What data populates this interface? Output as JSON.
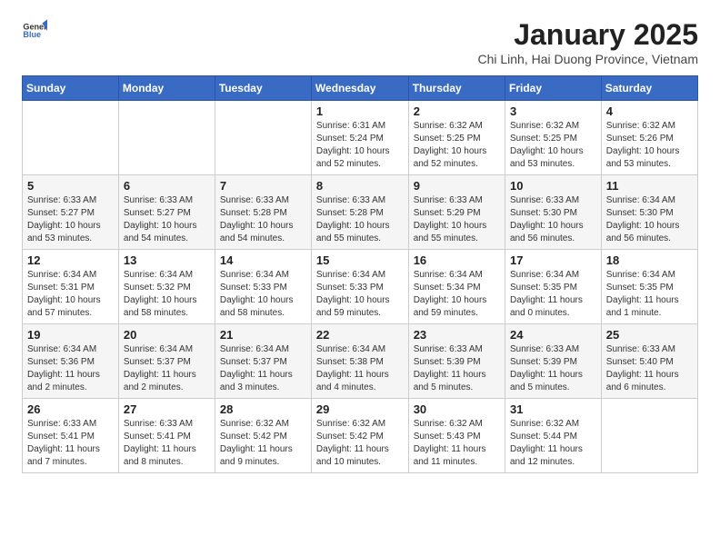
{
  "logo": {
    "general": "General",
    "blue": "Blue"
  },
  "title": "January 2025",
  "subtitle": "Chi Linh, Hai Duong Province, Vietnam",
  "days_of_week": [
    "Sunday",
    "Monday",
    "Tuesday",
    "Wednesday",
    "Thursday",
    "Friday",
    "Saturday"
  ],
  "weeks": [
    [
      {
        "day": "",
        "info": ""
      },
      {
        "day": "",
        "info": ""
      },
      {
        "day": "",
        "info": ""
      },
      {
        "day": "1",
        "info": "Sunrise: 6:31 AM\nSunset: 5:24 PM\nDaylight: 10 hours\nand 52 minutes."
      },
      {
        "day": "2",
        "info": "Sunrise: 6:32 AM\nSunset: 5:25 PM\nDaylight: 10 hours\nand 52 minutes."
      },
      {
        "day": "3",
        "info": "Sunrise: 6:32 AM\nSunset: 5:25 PM\nDaylight: 10 hours\nand 53 minutes."
      },
      {
        "day": "4",
        "info": "Sunrise: 6:32 AM\nSunset: 5:26 PM\nDaylight: 10 hours\nand 53 minutes."
      }
    ],
    [
      {
        "day": "5",
        "info": "Sunrise: 6:33 AM\nSunset: 5:27 PM\nDaylight: 10 hours\nand 53 minutes."
      },
      {
        "day": "6",
        "info": "Sunrise: 6:33 AM\nSunset: 5:27 PM\nDaylight: 10 hours\nand 54 minutes."
      },
      {
        "day": "7",
        "info": "Sunrise: 6:33 AM\nSunset: 5:28 PM\nDaylight: 10 hours\nand 54 minutes."
      },
      {
        "day": "8",
        "info": "Sunrise: 6:33 AM\nSunset: 5:28 PM\nDaylight: 10 hours\nand 55 minutes."
      },
      {
        "day": "9",
        "info": "Sunrise: 6:33 AM\nSunset: 5:29 PM\nDaylight: 10 hours\nand 55 minutes."
      },
      {
        "day": "10",
        "info": "Sunrise: 6:33 AM\nSunset: 5:30 PM\nDaylight: 10 hours\nand 56 minutes."
      },
      {
        "day": "11",
        "info": "Sunrise: 6:34 AM\nSunset: 5:30 PM\nDaylight: 10 hours\nand 56 minutes."
      }
    ],
    [
      {
        "day": "12",
        "info": "Sunrise: 6:34 AM\nSunset: 5:31 PM\nDaylight: 10 hours\nand 57 minutes."
      },
      {
        "day": "13",
        "info": "Sunrise: 6:34 AM\nSunset: 5:32 PM\nDaylight: 10 hours\nand 58 minutes."
      },
      {
        "day": "14",
        "info": "Sunrise: 6:34 AM\nSunset: 5:33 PM\nDaylight: 10 hours\nand 58 minutes."
      },
      {
        "day": "15",
        "info": "Sunrise: 6:34 AM\nSunset: 5:33 PM\nDaylight: 10 hours\nand 59 minutes."
      },
      {
        "day": "16",
        "info": "Sunrise: 6:34 AM\nSunset: 5:34 PM\nDaylight: 10 hours\nand 59 minutes."
      },
      {
        "day": "17",
        "info": "Sunrise: 6:34 AM\nSunset: 5:35 PM\nDaylight: 11 hours\nand 0 minutes."
      },
      {
        "day": "18",
        "info": "Sunrise: 6:34 AM\nSunset: 5:35 PM\nDaylight: 11 hours\nand 1 minute."
      }
    ],
    [
      {
        "day": "19",
        "info": "Sunrise: 6:34 AM\nSunset: 5:36 PM\nDaylight: 11 hours\nand 2 minutes."
      },
      {
        "day": "20",
        "info": "Sunrise: 6:34 AM\nSunset: 5:37 PM\nDaylight: 11 hours\nand 2 minutes."
      },
      {
        "day": "21",
        "info": "Sunrise: 6:34 AM\nSunset: 5:37 PM\nDaylight: 11 hours\nand 3 minutes."
      },
      {
        "day": "22",
        "info": "Sunrise: 6:34 AM\nSunset: 5:38 PM\nDaylight: 11 hours\nand 4 minutes."
      },
      {
        "day": "23",
        "info": "Sunrise: 6:33 AM\nSunset: 5:39 PM\nDaylight: 11 hours\nand 5 minutes."
      },
      {
        "day": "24",
        "info": "Sunrise: 6:33 AM\nSunset: 5:39 PM\nDaylight: 11 hours\nand 5 minutes."
      },
      {
        "day": "25",
        "info": "Sunrise: 6:33 AM\nSunset: 5:40 PM\nDaylight: 11 hours\nand 6 minutes."
      }
    ],
    [
      {
        "day": "26",
        "info": "Sunrise: 6:33 AM\nSunset: 5:41 PM\nDaylight: 11 hours\nand 7 minutes."
      },
      {
        "day": "27",
        "info": "Sunrise: 6:33 AM\nSunset: 5:41 PM\nDaylight: 11 hours\nand 8 minutes."
      },
      {
        "day": "28",
        "info": "Sunrise: 6:32 AM\nSunset: 5:42 PM\nDaylight: 11 hours\nand 9 minutes."
      },
      {
        "day": "29",
        "info": "Sunrise: 6:32 AM\nSunset: 5:42 PM\nDaylight: 11 hours\nand 10 minutes."
      },
      {
        "day": "30",
        "info": "Sunrise: 6:32 AM\nSunset: 5:43 PM\nDaylight: 11 hours\nand 11 minutes."
      },
      {
        "day": "31",
        "info": "Sunrise: 6:32 AM\nSunset: 5:44 PM\nDaylight: 11 hours\nand 12 minutes."
      },
      {
        "day": "",
        "info": ""
      }
    ]
  ]
}
